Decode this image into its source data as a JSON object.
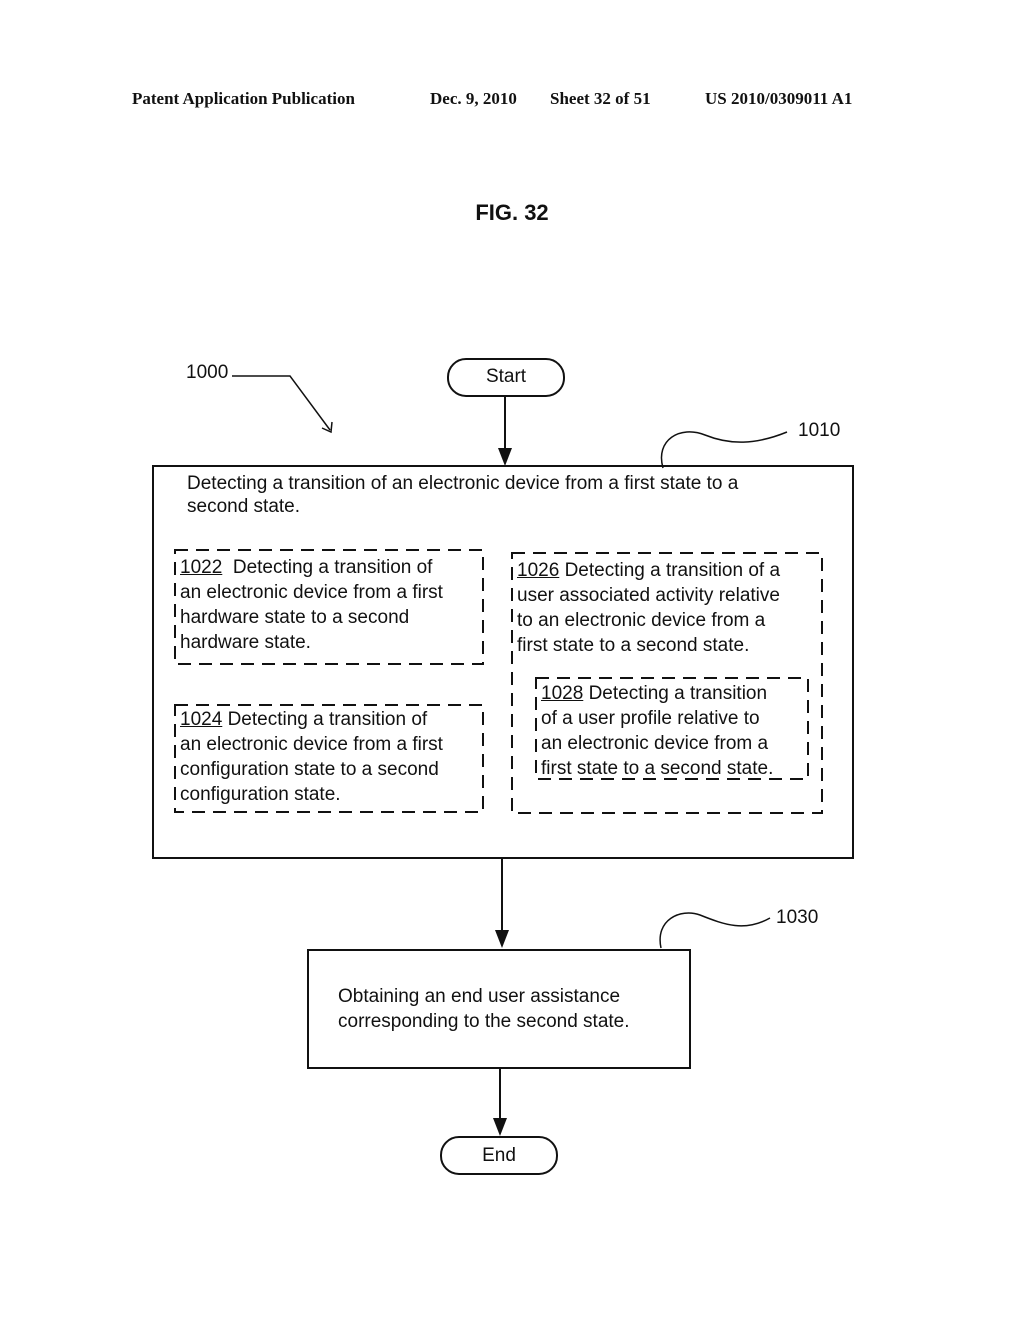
{
  "header": {
    "publication": "Patent Application Publication",
    "date": "Dec. 9, 2010",
    "sheet": "Sheet 32 of 51",
    "number": "US 2010/0309011 A1"
  },
  "figure": {
    "title": "FIG. 32",
    "diagram_ref": "1000",
    "start_label": "Start",
    "end_label": "End",
    "steps": [
      {
        "ref": "1010",
        "lines": [
          "Detecting a transition of an electronic device from a first state to a",
          "second state."
        ]
      },
      {
        "ref": "1022",
        "lines_after_ref": "Detecting a transition of",
        "lines": [
          "an electronic device from a first",
          "hardware state to a second",
          "hardware state."
        ]
      },
      {
        "ref": "1024",
        "lines_after_ref": "Detecting a transition of",
        "lines": [
          "an electronic device from a first",
          "configuration state to a second",
          "configuration state."
        ]
      },
      {
        "ref": "1026",
        "lines_after_ref": "Detecting a transition of a",
        "lines": [
          "user associated activity relative",
          "to an electronic device from a",
          "first state to a second state."
        ]
      },
      {
        "ref": "1028",
        "lines_after_ref": "Detecting a transition",
        "lines": [
          "of a user profile relative to",
          "an electronic device from a",
          "first state to a second state."
        ]
      },
      {
        "ref": "1030",
        "lines": [
          "Obtaining an end user assistance",
          "corresponding to the second state."
        ]
      }
    ]
  }
}
